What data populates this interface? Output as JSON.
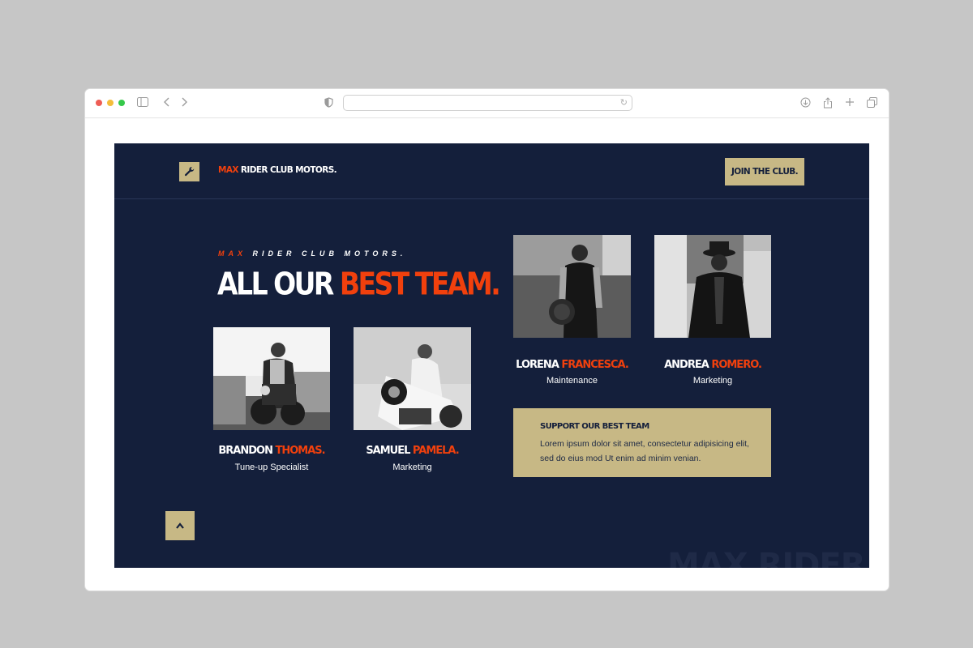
{
  "colors": {
    "navy": "#141f3b",
    "accent": "#f1400d",
    "gold": "#c7b885",
    "white": "#ffffff"
  },
  "browser": {
    "url": ""
  },
  "nav": {
    "brand_accent": "MAX",
    "brand_rest": " RIDER CLUB MOTORS.",
    "logo_icon": "wrench-icon",
    "join_label": "JOIN THE CLUB."
  },
  "hero": {
    "eyebrow_accent": "MAX",
    "eyebrow_rest": " RIDER CLUB MOTORS.",
    "heading_white": "ALL OUR ",
    "heading_accent": "BEST TEAM."
  },
  "team": [
    {
      "first": "BRANDON ",
      "last": "THOMAS.",
      "role": "Tune-up Specialist"
    },
    {
      "first": "SAMUEL ",
      "last": "PAMELA.",
      "role": "Marketing"
    },
    {
      "first": "LORENA ",
      "last": "FRANCESCA.",
      "role": "Maintenance"
    },
    {
      "first": "ANDREA ",
      "last": "ROMERO.",
      "role": "Marketing"
    }
  ],
  "support": {
    "title": "SUPPORT OUR BEST TEAM",
    "body": "Lorem ipsum dolor sit amet, consectetur adipisicing elit, sed do eius mod Ut enim ad minim venian."
  },
  "watermark": "MAX RIDER",
  "scroll_top_icon": "chevron-up-icon"
}
